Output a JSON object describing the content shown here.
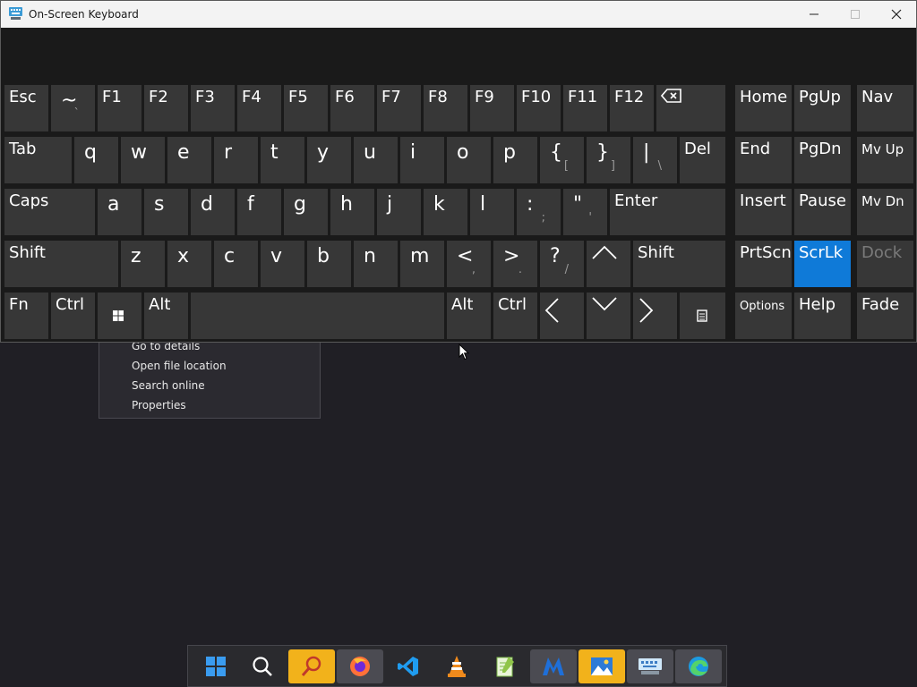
{
  "window": {
    "title": "On-Screen Keyboard",
    "controls": [
      "minimize",
      "maximize",
      "close"
    ]
  },
  "context_menu": {
    "items": [
      "Go to details",
      "Open file location",
      "Search online",
      "Properties"
    ]
  },
  "keyboard": {
    "row1": [
      {
        "label": "Esc"
      },
      {
        "label": "~",
        "sub": "`"
      },
      {
        "label": "F1"
      },
      {
        "label": "F2"
      },
      {
        "label": "F3"
      },
      {
        "label": "F4"
      },
      {
        "label": "F5"
      },
      {
        "label": "F6"
      },
      {
        "label": "F7"
      },
      {
        "label": "F8"
      },
      {
        "label": "F9"
      },
      {
        "label": "F10"
      },
      {
        "label": "F11"
      },
      {
        "label": "F12"
      },
      {
        "label": "",
        "icon": "backspace-icon"
      }
    ],
    "row2": [
      {
        "label": "Tab"
      },
      {
        "label": "q"
      },
      {
        "label": "w"
      },
      {
        "label": "e"
      },
      {
        "label": "r"
      },
      {
        "label": "t"
      },
      {
        "label": "y"
      },
      {
        "label": "u"
      },
      {
        "label": "i"
      },
      {
        "label": "o"
      },
      {
        "label": "p"
      },
      {
        "label": "{",
        "sub": "["
      },
      {
        "label": "}",
        "sub": "]"
      },
      {
        "label": "|",
        "sub": "\\"
      },
      {
        "label": "Del"
      }
    ],
    "row3": [
      {
        "label": "Caps"
      },
      {
        "label": "a"
      },
      {
        "label": "s"
      },
      {
        "label": "d"
      },
      {
        "label": "f"
      },
      {
        "label": "g"
      },
      {
        "label": "h"
      },
      {
        "label": "j"
      },
      {
        "label": "k"
      },
      {
        "label": "l"
      },
      {
        "label": ":",
        "sub": ";"
      },
      {
        "label": "\"",
        "sub": "'"
      },
      {
        "label": "Enter"
      }
    ],
    "row4": [
      {
        "label": "Shift"
      },
      {
        "label": "z"
      },
      {
        "label": "x"
      },
      {
        "label": "c"
      },
      {
        "label": "v"
      },
      {
        "label": "b"
      },
      {
        "label": "n"
      },
      {
        "label": "m"
      },
      {
        "label": "<",
        "sub": ","
      },
      {
        "label": ">",
        "sub": "."
      },
      {
        "label": "?",
        "sub": "/"
      },
      {
        "label": "",
        "icon": "arrow-up-icon"
      },
      {
        "label": "Shift"
      }
    ],
    "row5": [
      {
        "label": "Fn"
      },
      {
        "label": "Ctrl"
      },
      {
        "label": "",
        "icon": "windows-icon"
      },
      {
        "label": "Alt"
      },
      {
        "label": "",
        "name": "space"
      },
      {
        "label": "Alt"
      },
      {
        "label": "Ctrl"
      },
      {
        "label": "",
        "icon": "arrow-left-icon"
      },
      {
        "label": "",
        "icon": "arrow-down-icon"
      },
      {
        "label": "",
        "icon": "arrow-right-icon"
      },
      {
        "label": "",
        "icon": "menu-key-icon"
      }
    ],
    "nav": [
      [
        "Home",
        "PgUp",
        "Nav"
      ],
      [
        "End",
        "PgDn",
        "Mv Up"
      ],
      [
        "Insert",
        "Pause",
        "Mv Dn"
      ],
      [
        "PrtScn",
        "ScrLk",
        "Dock"
      ],
      [
        "Options",
        "Help",
        "Fade"
      ]
    ],
    "active_key": "ScrLk",
    "disabled_key": "Dock",
    "active_color": "#0f7ad8",
    "key_color": "#373737"
  },
  "taskbar": {
    "icons": [
      {
        "name": "start-icon"
      },
      {
        "name": "search-icon"
      },
      {
        "name": "search-app-icon",
        "state": "highlight"
      },
      {
        "name": "firefox-icon"
      },
      {
        "name": "vscode-icon"
      },
      {
        "name": "vlc-icon"
      },
      {
        "name": "notepad-plus-icon"
      },
      {
        "name": "app-m-icon",
        "state": "open"
      },
      {
        "name": "photos-icon",
        "state": "highlight"
      },
      {
        "name": "osk-icon",
        "state": "open"
      },
      {
        "name": "edge-icon",
        "state": "open"
      }
    ],
    "highlight_color": "#f2b21b"
  }
}
